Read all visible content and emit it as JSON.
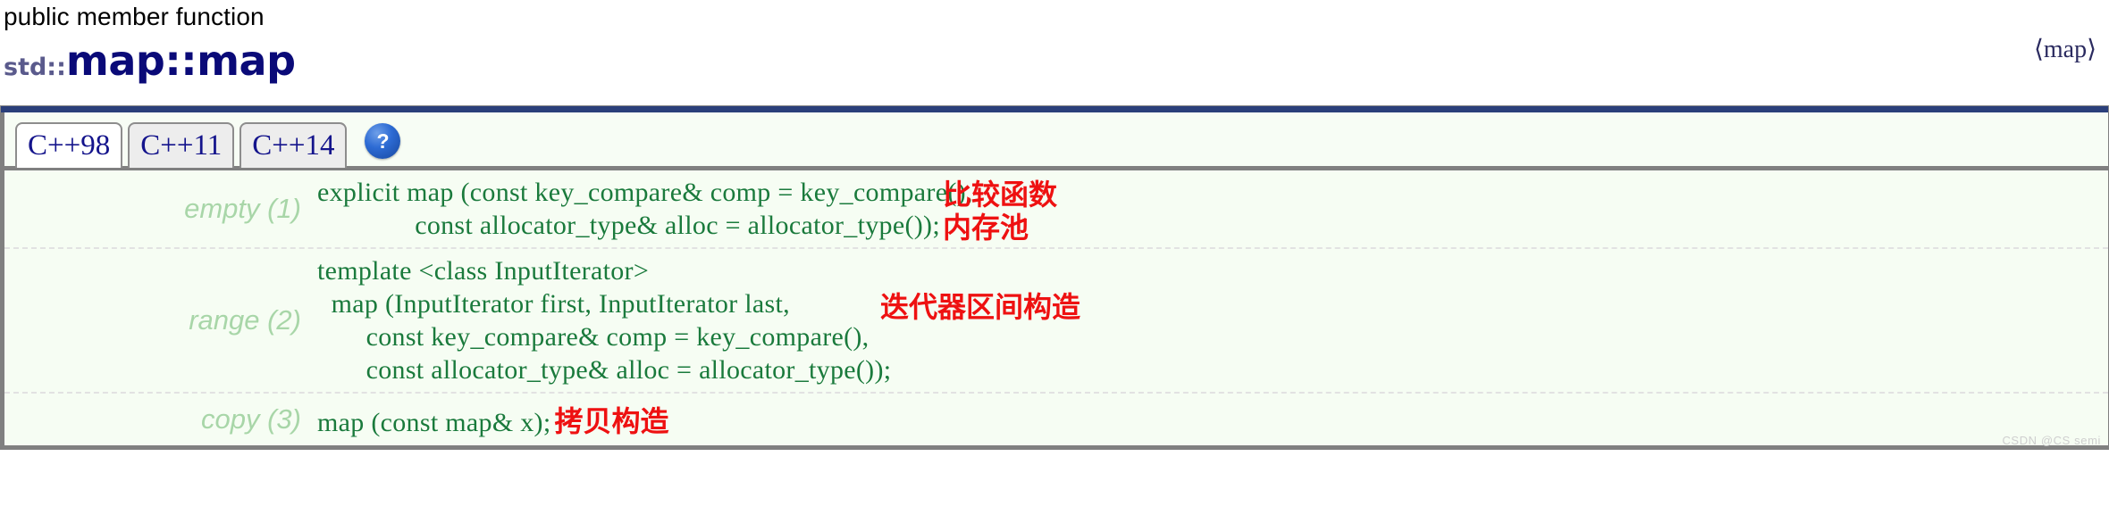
{
  "header": {
    "kind": "public member function",
    "namespace": "std::",
    "symbol_primary": "map",
    "symbol_separator": "::",
    "symbol_secondary": "map",
    "include_header": "⟨map⟩"
  },
  "tabs": [
    {
      "label": "C++98",
      "active": true
    },
    {
      "label": "C++11",
      "active": false
    },
    {
      "label": "C++14",
      "active": false
    }
  ],
  "help": {
    "glyph": "?",
    "name": "help-icon"
  },
  "signatures": [
    {
      "label": "empty (1)",
      "code": "explicit map (const key_compare& comp = key_compare(),\n              const allocator_type& alloc = allocator_type());",
      "annotations": [
        {
          "text": "比较函数",
          "placement": "a-comp"
        },
        {
          "text": "内存池",
          "placement": "a-pool"
        }
      ]
    },
    {
      "label": "range (2)",
      "code": "template <class InputIterator>\n  map (InputIterator first, InputIterator last,\n       const key_compare& comp = key_compare(),\n       const allocator_type& alloc = allocator_type());",
      "annotations": [
        {
          "text": "迭代器区间构造",
          "placement": "a-range"
        }
      ]
    },
    {
      "label": "copy (3)",
      "code": "map (const map& x);",
      "inline_annotation": "拷贝构造",
      "annotations": []
    }
  ],
  "watermark": "CSDN @CS semi",
  "colors": {
    "title_primary": "#0a0a78",
    "title_namespace": "#5a5a8c",
    "tab_text": "#14148c",
    "topbar": "#2a3f7a",
    "code_text": "#1a7a3c",
    "label_text": "#a8d6a8",
    "annotation_red": "#ee1111",
    "panel_bg": "#f6fdf3",
    "panel_border": "#808080"
  }
}
